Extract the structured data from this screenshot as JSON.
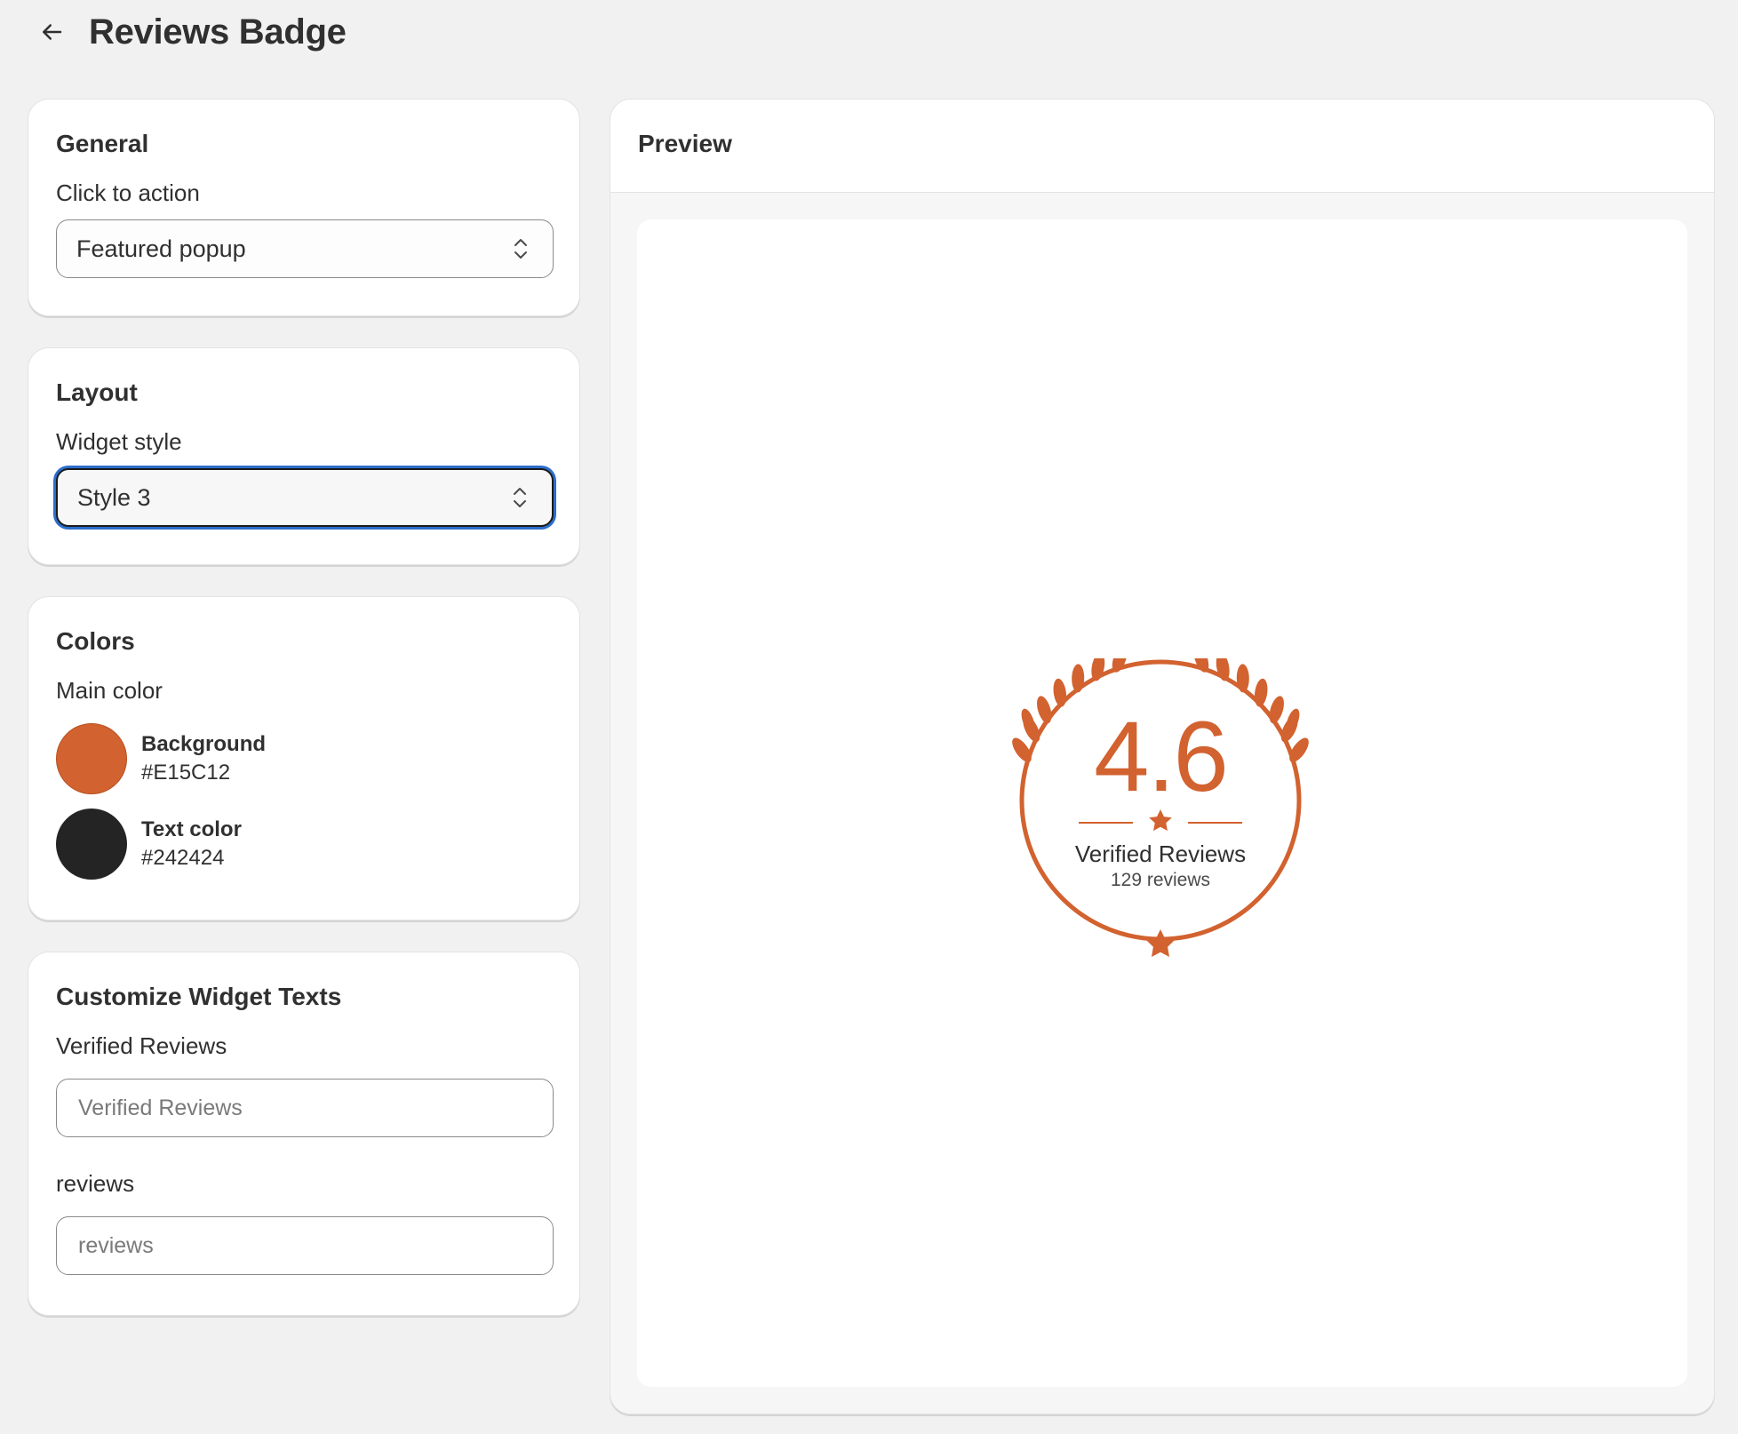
{
  "header": {
    "title": "Reviews Badge",
    "back_icon": "arrow-left-icon"
  },
  "general": {
    "title": "General",
    "click_action_label": "Click to action",
    "click_action_value": "Featured popup"
  },
  "layout": {
    "title": "Layout",
    "widget_style_label": "Widget style",
    "widget_style_value": "Style 3"
  },
  "colors": {
    "title": "Colors",
    "main_color_label": "Main color",
    "background": {
      "label": "Background",
      "hex": "#E15C12",
      "swatch": "#D2622F"
    },
    "text_color": {
      "label": "Text color",
      "hex": "#242424",
      "swatch": "#242424"
    }
  },
  "texts": {
    "title": "Customize Widget Texts",
    "verified_label": "Verified Reviews",
    "verified_placeholder": "Verified Reviews",
    "reviews_label": "reviews",
    "reviews_placeholder": "reviews"
  },
  "preview": {
    "title": "Preview",
    "badge": {
      "rating": "4.6",
      "title": "Verified Reviews",
      "count": "129 reviews",
      "color": "#D2622F"
    }
  }
}
